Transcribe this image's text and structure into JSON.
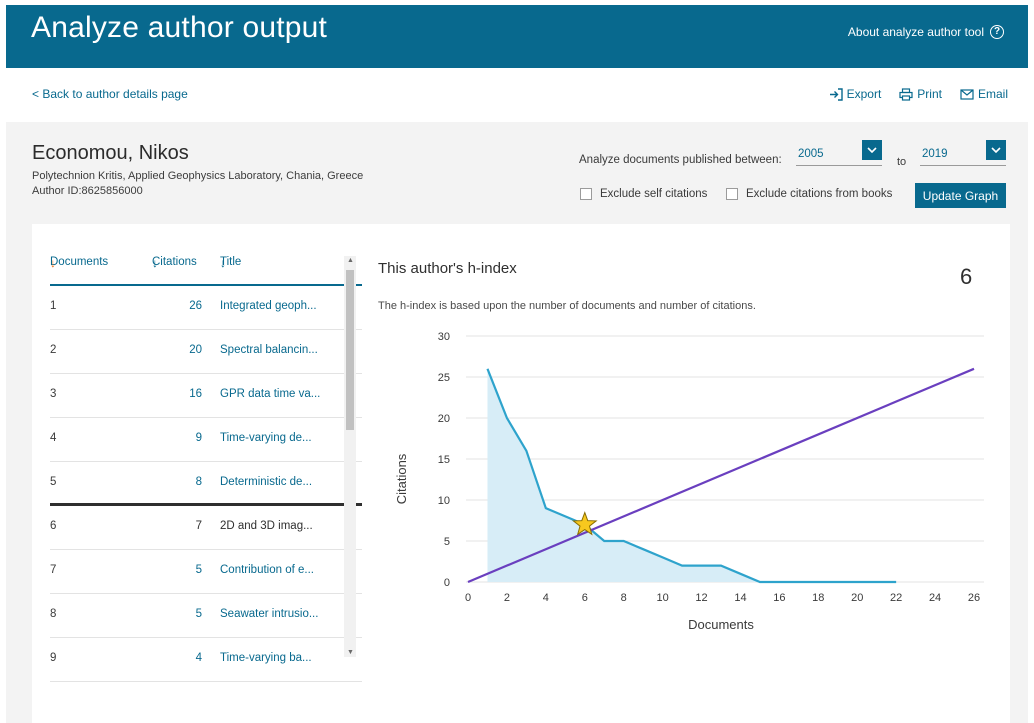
{
  "header": {
    "title": "Analyze author output",
    "about_link": "About analyze author tool",
    "help_icon_glyph": "?"
  },
  "nav": {
    "back_link": "< Back to author details page",
    "export_label": "Export",
    "print_label": "Print",
    "email_label": "Email"
  },
  "author": {
    "name": "Economou, Nikos",
    "affiliation": "Polytechnion Kritis, Applied Geophysics Laboratory, Chania, Greece",
    "author_id": "Author ID:8625856000"
  },
  "filters": {
    "range_label": "Analyze documents published between:",
    "from_year": "2005",
    "to_label": "to",
    "to_year": "2019",
    "exclude_self_citations": "Exclude self citations",
    "exclude_book_citations": "Exclude citations from books",
    "update_button": "Update Graph"
  },
  "table": {
    "col_documents": "Documents",
    "col_citations": "Citations",
    "col_title": "Title",
    "rows": [
      {
        "n": "1",
        "citations": "26",
        "title": "Integrated geoph..."
      },
      {
        "n": "2",
        "citations": "20",
        "title": "Spectral balancin..."
      },
      {
        "n": "3",
        "citations": "16",
        "title": "GPR data time va..."
      },
      {
        "n": "4",
        "citations": "9",
        "title": "Time-varying de..."
      },
      {
        "n": "5",
        "citations": "8",
        "title": "Deterministic de..."
      },
      {
        "n": "6",
        "citations": "7",
        "title": "2D and 3D imag..."
      },
      {
        "n": "7",
        "citations": "5",
        "title": "Contribution of e..."
      },
      {
        "n": "8",
        "citations": "5",
        "title": "Seawater intrusio..."
      },
      {
        "n": "9",
        "citations": "4",
        "title": "Time-varying ba..."
      }
    ]
  },
  "hindex": {
    "title": "This author's h-index",
    "value": "6",
    "description": "The h-index is based upon the number of documents and number of citations."
  },
  "chart_data": {
    "type": "area",
    "xlabel": "Documents",
    "ylabel": "Citations",
    "xlim": [
      0,
      26
    ],
    "ylim": [
      0,
      30
    ],
    "x_ticks": [
      0,
      2,
      4,
      6,
      8,
      10,
      12,
      14,
      16,
      18,
      20,
      22,
      24,
      26
    ],
    "y_ticks": [
      0,
      5,
      10,
      15,
      20,
      25,
      30
    ],
    "grid": true,
    "series": [
      {
        "values_x": [
          1,
          2,
          3,
          4,
          5,
          6,
          7,
          8,
          9,
          10,
          11,
          12,
          13,
          14,
          15,
          16,
          17,
          18,
          19,
          20,
          21,
          22
        ],
        "values_y": [
          26,
          20,
          16,
          9,
          8,
          7,
          5,
          5,
          4,
          3,
          2,
          2,
          2,
          1,
          0,
          0,
          0,
          0,
          0,
          0,
          0,
          0
        ],
        "color": "#2ea3cc",
        "fill": "#d7edf7"
      },
      {
        "values_x": [
          0,
          26
        ],
        "values_y": [
          0,
          26
        ],
        "color": "#6a3fbf"
      }
    ],
    "h_index_point": {
      "x": 6,
      "y": 7,
      "marker": "star",
      "color": "#f7c81e"
    }
  }
}
